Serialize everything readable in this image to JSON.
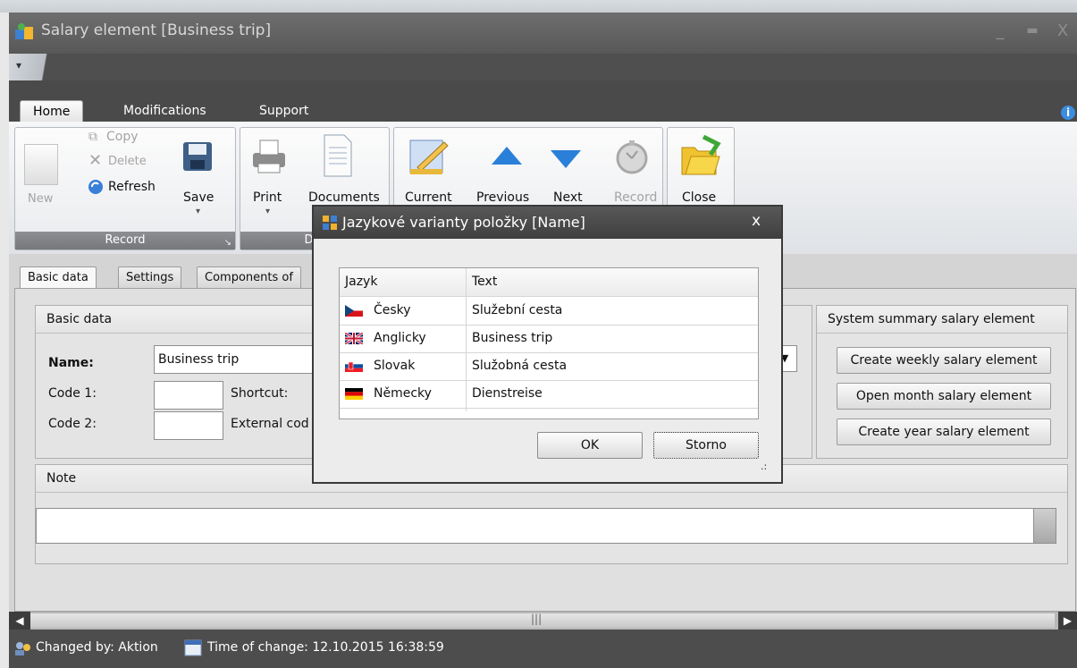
{
  "window": {
    "title": "Salary element [Business trip]"
  },
  "ribbon": {
    "tabs": [
      "Home",
      "Modifications",
      "Support"
    ],
    "record_group": {
      "label": "Record",
      "new": "New",
      "copy": "Copy",
      "delete": "Delete",
      "refresh": "Refresh",
      "save": "Save"
    },
    "data_group": {
      "label": "Dat",
      "print": "Print",
      "documents": "Documents"
    },
    "nav_group": {
      "current": "Current",
      "previous": "Previous",
      "next": "Next",
      "record": "Record"
    },
    "close_group": {
      "close": "Close"
    }
  },
  "content_tabs": [
    "Basic data",
    "Settings",
    "Components of"
  ],
  "basic_data": {
    "panel_title": "Basic data",
    "name_label": "Name:",
    "name_value": "Business trip",
    "code1_label": "Code 1:",
    "shortcut_label": "Shortcut:",
    "code2_label": "Code 2:",
    "external_code_label": "External cod"
  },
  "system_summary": {
    "title": "System summary salary element",
    "buttons": [
      "Create weekly salary element",
      "Open month salary element",
      "Create year salary element"
    ]
  },
  "note": {
    "title": "Note",
    "value": ""
  },
  "status": {
    "changed_by": "Changed by: Aktion",
    "time_of_change": "Time of change: 12.10.2015 16:38:59"
  },
  "dialog": {
    "title": "Jazykové varianty položky [Name]",
    "columns": [
      "Jazyk",
      "Text"
    ],
    "rows": [
      {
        "lang": "Česky",
        "text": "Služební cesta",
        "flag": "cz"
      },
      {
        "lang": "Anglicky",
        "text": "Business trip",
        "flag": "gb"
      },
      {
        "lang": "Slovak",
        "text": "Služobná cesta",
        "flag": "sk"
      },
      {
        "lang": "Německy",
        "text": "Dienstreise",
        "flag": "de"
      }
    ],
    "ok": "OK",
    "cancel": "Storno"
  }
}
